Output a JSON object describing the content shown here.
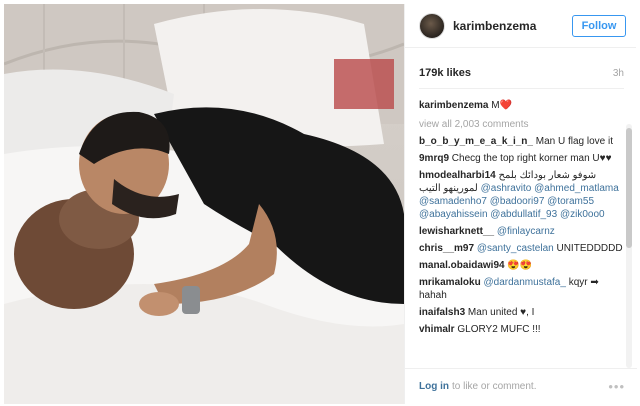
{
  "post": {
    "username": "karimbenzema",
    "follow_label": "Follow",
    "likes": "179k likes",
    "time": "3h",
    "caption_author": "karimbenzema",
    "caption_text": "M❤️",
    "view_all": "view all 2,003 comments"
  },
  "comments": [
    {
      "author": "b_o_b_y_m_e_a_k_i_n_",
      "text": "Man U flag love it",
      "tags": ""
    },
    {
      "author": "9mrq9",
      "text": "Checg the top right korner man U♥♥",
      "tags": ""
    },
    {
      "author": "hmodealharbi14",
      "text": "شوفو شعار بودائك بلمح لمورينهو التيب",
      "tags": "@ashravito @ahmed_matlama @samadenho7 @badoori97 @toram55 @abayahissein @abdullatif_93 @zik0oo0"
    },
    {
      "author": "lewisharknett__",
      "text": "",
      "tags": "@finlaycarnz"
    },
    {
      "author": "chris__m97",
      "text": "UNITEDDDDD",
      "tags": "@santy_castelan"
    },
    {
      "author": "manal.obaidawi94",
      "text": "😍😍",
      "tags": ""
    },
    {
      "author": "mrikamaloku",
      "text": "kqyr ➡ hahah",
      "tags": "@dardanmustafa_"
    },
    {
      "author": "inaifalsh3",
      "text": "Man united ♥, I",
      "tags": ""
    },
    {
      "author": "vhimalr",
      "text": "GLORY2 MUFC !!!",
      "tags": ""
    }
  ],
  "footer": {
    "login_label": "Log in",
    "rest": "to like or comment.",
    "more": "•••"
  }
}
